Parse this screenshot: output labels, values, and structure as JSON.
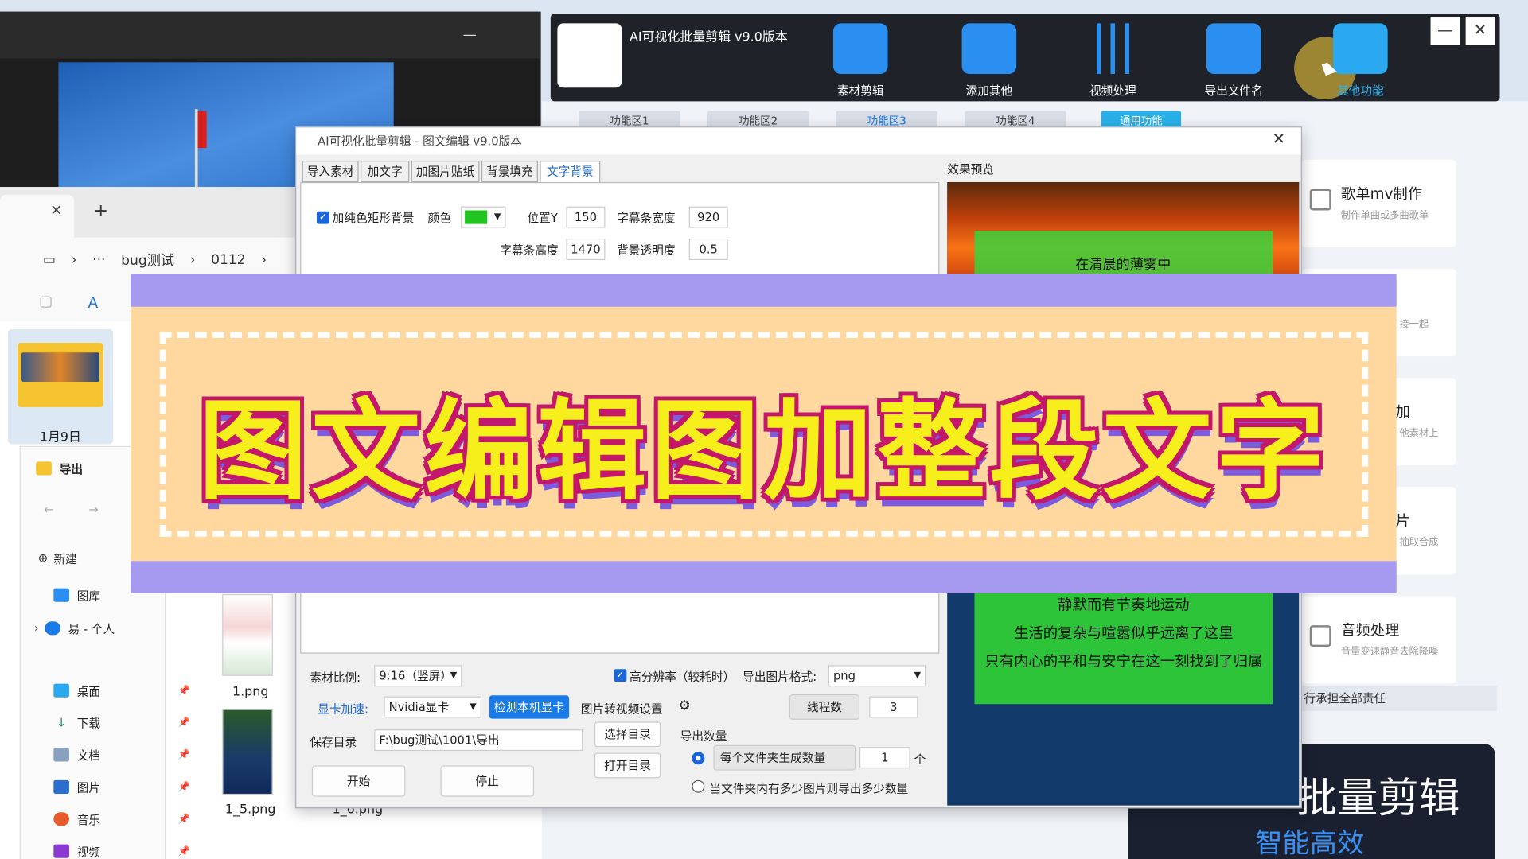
{
  "explorer": {
    "address": [
      "bug测试",
      "0112"
    ],
    "folder_label": "1月9日",
    "nav_title": "导出",
    "new_label": "新建",
    "nav_items": [
      {
        "label": "图库",
        "icon": "gallery-icon"
      },
      {
        "label": "易 - 个人",
        "icon": "cloud-icon"
      },
      {
        "label": "桌面",
        "icon": "desktop-icon"
      },
      {
        "label": "下载",
        "icon": "download-icon"
      },
      {
        "label": "文档",
        "icon": "document-icon"
      },
      {
        "label": "图片",
        "icon": "pictures-icon"
      },
      {
        "label": "音乐",
        "icon": "music-icon"
      },
      {
        "label": "视频",
        "icon": "video-icon"
      }
    ],
    "files": [
      "1.png",
      "1_5.png",
      "1_6.png"
    ]
  },
  "app": {
    "title": "AI可视化批量剪辑 v9.0版本",
    "toolbar": [
      {
        "label": "素材剪辑",
        "icon": "clapperboard-icon",
        "color": "#2a8ff0"
      },
      {
        "label": "添加其他",
        "icon": "add-layers-icon",
        "color": "#2a8ff0"
      },
      {
        "label": "视频处理",
        "icon": "sliders-icon",
        "color": "#2a8ff0"
      },
      {
        "label": "导出文件名",
        "icon": "export-file-icon",
        "color": "#2a8ff0"
      },
      {
        "label": "其他功能",
        "icon": "grid-apps-icon",
        "color": "#2aa8f0"
      }
    ],
    "subtabs": [
      "功能区1",
      "功能区2",
      "功能区3",
      "功能区4",
      "通用功能"
    ],
    "cards": [
      {
        "title": "歌单mv制作",
        "sub": "制作单曲或多曲歌单"
      },
      {
        "title": "",
        "sub": "接一起"
      },
      {
        "title": "加",
        "sub": "他素材上"
      },
      {
        "title": "片",
        "sub": "抽取合成"
      },
      {
        "title": "音频处理",
        "sub": "音量变速静音去除降噪"
      }
    ],
    "policy_text": "行承担全部责任",
    "promo_a": "批量剪辑",
    "promo_b": "智能高效",
    "accent": "#1a7ae8"
  },
  "dialog": {
    "title": "AI可视化批量剪辑 - 图文编辑 v9.0版本",
    "tabs": [
      "导入素材",
      "加文字",
      "加图片贴纸",
      "背景填充",
      "文字背景"
    ],
    "active_tab": "文字背景",
    "bg_checkbox": "加纯色矩形背景",
    "color_label": "颜色",
    "color_value": "#22c422",
    "pos_y_label": "位置Y",
    "pos_y": "150",
    "bar_width_label": "字幕条宽度",
    "bar_width": "920",
    "bar_height_label": "字幕条高度",
    "bar_height": "1470",
    "opacity_label": "背景透明度",
    "opacity": "0.5",
    "ratio_label": "素材比例:",
    "ratio_value": "9:16（竖屏）",
    "hires_label": "高分辨率（较耗时）",
    "format_label": "导出图片格式:",
    "format_value": "png",
    "gpu_label": "显卡加速:",
    "gpu_value": "Nvidia显卡",
    "detect_btn": "检测本机显卡",
    "img2video_label": "图片转视频设置",
    "threads_label": "线程数",
    "threads": "3",
    "save_label": "保存目录",
    "save_path": "F:\\bug测试\\1001\\导出",
    "choose_btn": "选择目录",
    "open_btn": "打开目录",
    "start_btn": "开始",
    "stop_btn": "停止",
    "export_count_label": "导出数量",
    "per_folder_label": "每个文件夹生成数量",
    "per_folder_value": "1",
    "per_folder_unit": "个",
    "all_label": "当文件夹内有多少图片则导出多少数量",
    "preview_label": "效果预览",
    "preview_top_text": "在清晨的薄雾中",
    "preview_lines": [
      "静默而有节奏地运动",
      "生活的复杂与喧嚣似乎远离了这里",
      "只有内心的平和与安宁在这一刻找到了归属"
    ]
  },
  "banner": {
    "headline": "图文编辑图加整段文字"
  }
}
